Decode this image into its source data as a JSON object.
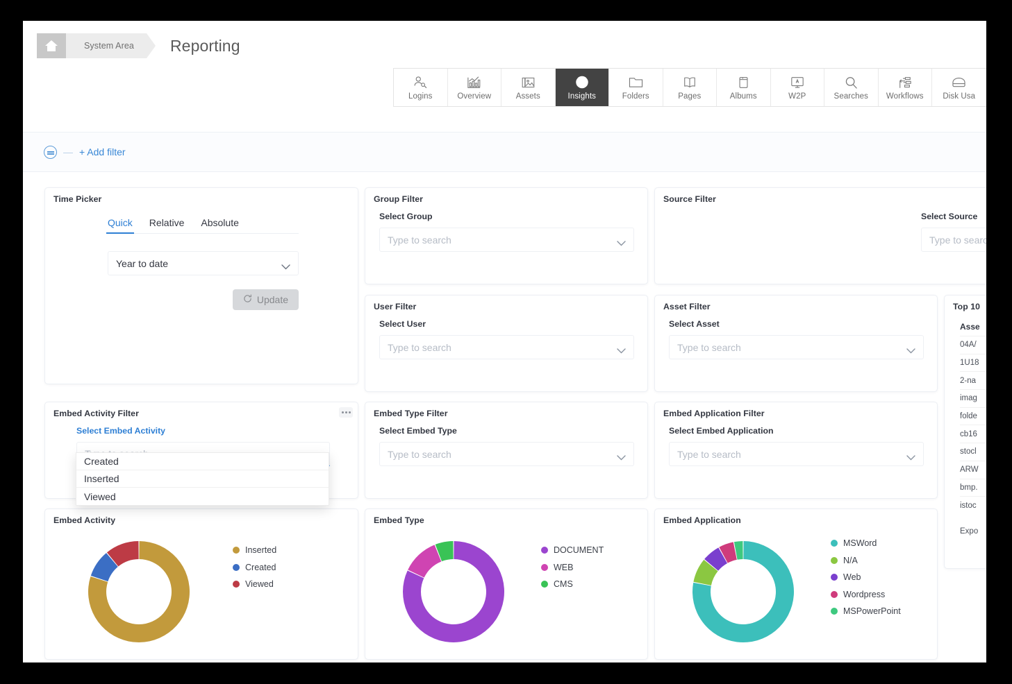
{
  "breadcrumb": {
    "home_icon": "home-icon",
    "section": "System Area",
    "title": "Reporting"
  },
  "tabs": [
    {
      "label": "Logins",
      "icon": "users-key-icon",
      "active": false
    },
    {
      "label": "Overview",
      "icon": "bar-chart-icon",
      "active": false
    },
    {
      "label": "Assets",
      "icon": "image-icon",
      "active": false
    },
    {
      "label": "Insights",
      "icon": "globe-icon",
      "active": true
    },
    {
      "label": "Folders",
      "icon": "folder-icon",
      "active": false
    },
    {
      "label": "Pages",
      "icon": "book-icon",
      "active": false
    },
    {
      "label": "Albums",
      "icon": "album-icon",
      "active": false
    },
    {
      "label": "W2P",
      "icon": "monitor-a-icon",
      "active": false
    },
    {
      "label": "Searches",
      "icon": "search-icon",
      "active": false
    },
    {
      "label": "Workflows",
      "icon": "workflow-icon",
      "active": false
    },
    {
      "label": "Disk Usa",
      "icon": "disk-icon",
      "active": false
    }
  ],
  "filter_bar": {
    "icon": "filter-icon",
    "dash": "—",
    "add_filter_label": "+ Add filter"
  },
  "time_picker": {
    "title": "Time Picker",
    "tabs": [
      "Quick",
      "Relative",
      "Absolute"
    ],
    "active_tab": "Quick",
    "range_value": "Year to date",
    "update_label": "Update",
    "refresh_icon": "refresh-icon"
  },
  "filters": [
    {
      "card_title": "Group Filter",
      "label": "Select Group",
      "placeholder": "Type to search"
    },
    {
      "card_title": "Source Filter",
      "label": "Select Source",
      "placeholder": "Type to searc"
    },
    {
      "card_title": "User Filter",
      "label": "Select User",
      "placeholder": "Type to search"
    },
    {
      "card_title": "Asset Filter",
      "label": "Select Asset",
      "placeholder": "Type to search"
    },
    {
      "card_title": "Embed Activity Filter",
      "label": "Select Embed Activity",
      "placeholder": "Type to search"
    },
    {
      "card_title": "Embed Type Filter",
      "label": "Select Embed Type",
      "placeholder": "Type to search"
    },
    {
      "card_title": "Embed Application Filter",
      "label": "Select Embed Application",
      "placeholder": "Type to search"
    }
  ],
  "embed_activity_dropdown": {
    "options": [
      "Created",
      "Inserted",
      "Viewed"
    ]
  },
  "top10": {
    "title": "Top 10",
    "column_header": "Asse",
    "rows": [
      "04A/",
      "1U18",
      "2-na",
      "imag",
      "folde",
      "cb16",
      "stocl",
      "ARW",
      "bmp.",
      "istoc"
    ],
    "export_label": "Expo"
  },
  "chart_data": [
    {
      "type": "pie",
      "title": "Embed Activity",
      "donut": true,
      "legend_position": "right",
      "categories": [
        "Inserted",
        "Created",
        "Viewed"
      ],
      "values": [
        80,
        9,
        11
      ],
      "colors": [
        "#c29a3c",
        "#3b6ec4",
        "#bd3b45"
      ]
    },
    {
      "type": "pie",
      "title": "Embed Type",
      "donut": true,
      "legend_position": "right",
      "categories": [
        "DOCUMENT",
        "WEB",
        "CMS"
      ],
      "values": [
        82,
        12,
        6
      ],
      "colors": [
        "#9b45cf",
        "#cf44b2",
        "#39c356"
      ]
    },
    {
      "type": "pie",
      "title": "Embed Application",
      "donut": true,
      "legend_position": "right",
      "categories": [
        "MSWord",
        "N/A",
        "Web",
        "Wordpress",
        "MSPowerPoint"
      ],
      "values": [
        78,
        8,
        6,
        5,
        3
      ],
      "colors": [
        "#3cbfbb",
        "#8bc741",
        "#7a3fce",
        "#cf3b7c",
        "#3ec97f"
      ]
    }
  ]
}
